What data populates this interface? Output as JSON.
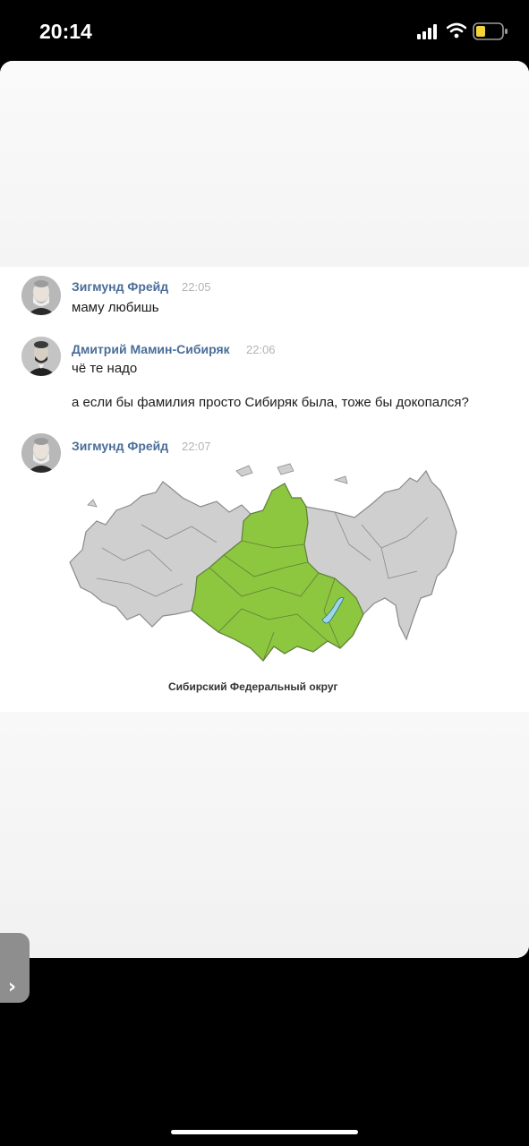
{
  "status_bar": {
    "time": "20:14",
    "icons": [
      "signal-icon",
      "wifi-icon",
      "battery-icon"
    ],
    "battery_color": "#f5d33a"
  },
  "post": {
    "messages": [
      {
        "author": "Зигмунд Фрейд",
        "time": "22:05",
        "lines": [
          "маму любишь"
        ]
      },
      {
        "author": "Дмитрий Мамин-Сибиряк",
        "time": "22:06",
        "lines": [
          "чё те надо",
          "а если бы фамилия просто Сибиряк была, тоже бы докопался?"
        ]
      },
      {
        "author": "Зигмунд Фрейд",
        "time": "22:07",
        "lines": []
      }
    ],
    "map": {
      "caption": "Сибирский Федеральный округ",
      "highlight_color": "#8dc63f",
      "base_color": "#cfcfcf"
    }
  },
  "side_tab": {
    "chevron": "›"
  },
  "colors": {
    "author": "#4a6d99",
    "timestamp": "#b0b4ba"
  }
}
